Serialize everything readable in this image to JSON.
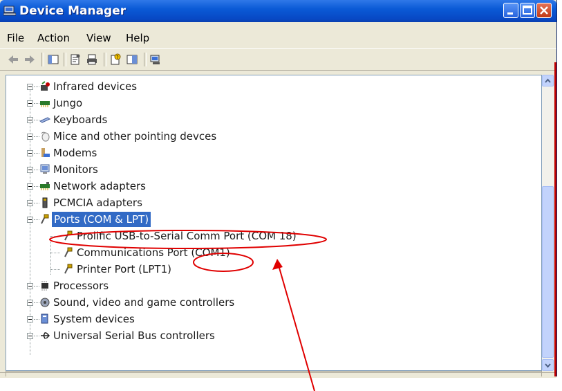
{
  "window": {
    "title": "Device Manager"
  },
  "menu": [
    "File",
    "Action",
    "View",
    "Help"
  ],
  "toolbar": [
    "back-icon",
    "forward-icon",
    "console-tree-icon",
    "properties-icon",
    "print-icon",
    "help-icon",
    "details-icon",
    "scan-hardware-icon"
  ],
  "tree": {
    "items": [
      {
        "label": "Infrared devices",
        "icon": "infrared-icon"
      },
      {
        "label": "Jungo",
        "icon": "jungo-icon"
      },
      {
        "label": "Keyboards",
        "icon": "keyboard-icon"
      },
      {
        "label": "Mice and other pointing devces",
        "icon": "mouse-icon"
      },
      {
        "label": "Modems",
        "icon": "modem-icon"
      },
      {
        "label": "Monitors",
        "icon": "monitor-icon"
      },
      {
        "label": "Network adapters",
        "icon": "network-adapter-icon"
      },
      {
        "label": "PCMCIA adapters",
        "icon": "pcmcia-icon"
      },
      {
        "label": "Ports (COM & LPT)",
        "icon": "port-icon",
        "selected": true
      },
      {
        "label": "Prolific USB-to-Serial Comm Port (COM 18)",
        "icon": "port-icon",
        "child": true
      },
      {
        "label": "Communications Port (COM1)",
        "icon": "port-icon",
        "child": true
      },
      {
        "label": "Printer Port (LPT1)",
        "icon": "port-icon",
        "child": true
      },
      {
        "label": "Processors",
        "icon": "processor-icon"
      },
      {
        "label": "Sound, video and game controllers",
        "icon": "sound-icon"
      },
      {
        "label": "System devices",
        "icon": "system-icon"
      },
      {
        "label": "Universal Serial Bus controllers",
        "icon": "usb-icon"
      }
    ]
  },
  "annotations": {
    "circle_color": "#e00000",
    "arrow_color": "#e00000"
  }
}
